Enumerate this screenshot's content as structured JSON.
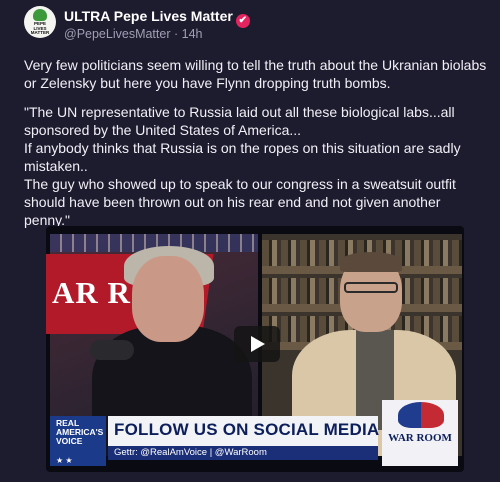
{
  "post": {
    "author_name": "ULTRA Pepe Lives Matter",
    "verified_glyph": "✔",
    "handle": "@PepeLivesMatter",
    "separator": "·",
    "time": "14h",
    "avatar_badge": "PEPE LIVES MATTER",
    "paragraph1": "Very few politicians seem willing to tell the truth about the Ukranian biolabs or Zelensky but here you have Flynn dropping truth bombs.",
    "quote_lines": [
      "\"The UN representative to Russia laid out all these biological labs...all sponsored by the United States of America...",
      "If anybody thinks that Russia is on the ropes on this situation are sadly mistaken..",
      "The guy who showed up to speak to our congress in a sweatsuit outfit should have been thrown out on his rear end and not given another penny.\""
    ]
  },
  "video": {
    "backdrop_text": "AR RO",
    "lower_third": {
      "channel_badge": "REAL AMERICA'S VOICE",
      "channel_stars": "★          ★",
      "headline": "FOLLOW US ON SOCIAL MEDIA",
      "subline": "Gettr: @RealAmVoice | @WarRoom",
      "logo_text": "WAR ROOM"
    }
  },
  "colors": {
    "background": "#1d1b2e",
    "verified": "#e3245f",
    "banner_blue": "#0c1f5a"
  },
  "icons": [
    "verified-badge-icon",
    "play-icon"
  ]
}
